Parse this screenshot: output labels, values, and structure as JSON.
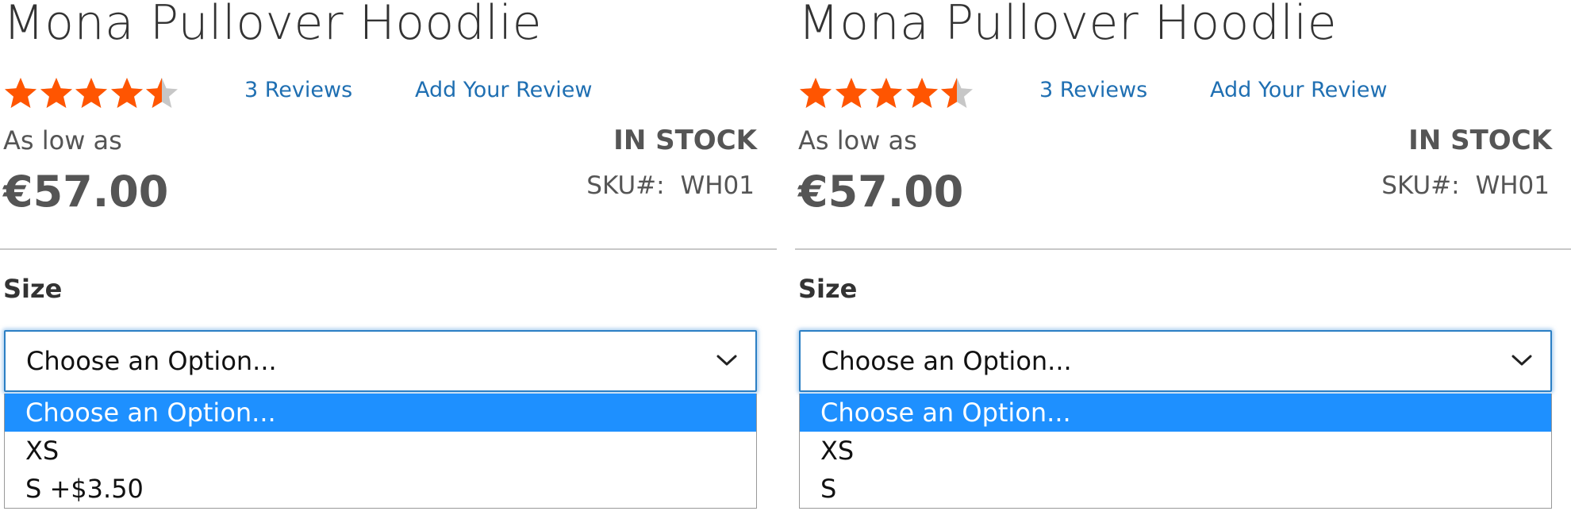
{
  "panels": [
    {
      "title": "Mona Pullover Hoodlie",
      "rating": {
        "stars_filled": 4.5,
        "stars_total": 5
      },
      "reviews_link": "3  Reviews",
      "add_review_link": "Add Your Review",
      "as_low_as": "As low as",
      "price": "€57.00",
      "stock": "IN STOCK",
      "sku_label": "SKU#:",
      "sku_value": "WH01",
      "size_label": "Size",
      "select_value": "Choose an Option...",
      "options": [
        "Choose an Option...",
        "XS",
        "S +$3.50"
      ]
    },
    {
      "title": "Mona Pullover Hoodlie",
      "rating": {
        "stars_filled": 4.5,
        "stars_total": 5
      },
      "reviews_link": "3  Reviews",
      "add_review_link": "Add Your Review",
      "as_low_as": "As low as",
      "price": "€57.00",
      "stock": "IN STOCK",
      "sku_label": "SKU#:",
      "sku_value": "WH01",
      "size_label": "Size",
      "select_value": "Choose an Option...",
      "options": [
        "Choose an Option...",
        "XS",
        "S"
      ]
    }
  ],
  "colors": {
    "star_filled": "#ff5501",
    "star_empty": "#c7c7c7",
    "link": "#1f6fb2",
    "option_highlight": "#1e90ff",
    "focus_border": "#2b7fc4"
  },
  "icons": {
    "star": "star-icon",
    "chevron": "chevron-down-icon"
  }
}
